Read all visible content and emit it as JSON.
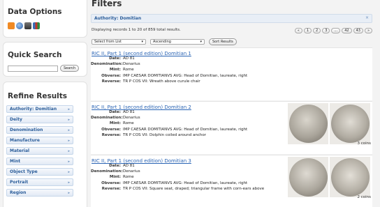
{
  "sidebar": {
    "data_options": "Data Options",
    "icons": [
      {
        "name": "rss-icon",
        "color": "#f08a24"
      },
      {
        "name": "globe-icon",
        "color": "#3a6db5"
      },
      {
        "name": "kml-icon",
        "color": "#666666"
      },
      {
        "name": "chart-icon",
        "color": "#c0392b"
      }
    ],
    "quick_search": "Quick Search",
    "search_button": "Search",
    "search_value": "",
    "refine_results": "Refine Results",
    "facets": [
      "Authority: Domitian",
      "Deity",
      "Denomination",
      "Manufacture",
      "Material",
      "Mint",
      "Object Type",
      "Portrait",
      "Region"
    ]
  },
  "main": {
    "title": "Filters",
    "filter_label": "Authority: Domitian",
    "filter_close": "×",
    "info": "Displaying records 1 to 20 of 859 total results.",
    "pager": [
      "«",
      "1",
      "2",
      "3",
      "...",
      "42",
      "43",
      "»"
    ],
    "sort_select": "Select from List",
    "sort_order": "Ascending",
    "sort_button": "Sort Results"
  },
  "records": [
    {
      "title": "RIC II, Part 1 (second edition) Domitian 1",
      "fields": [
        {
          "label": "Date:",
          "value": "AD 81"
        },
        {
          "label": "Denomination:",
          "value": "Denarius"
        },
        {
          "label": "Mint:",
          "value": "Rome"
        },
        {
          "label": "Obverse:",
          "value": "IMP CAESAR DOMITIANVS AVG: Head of Domitian, laureate, right"
        },
        {
          "label": "Reverse:",
          "value": "TR P COS VII: Wreath above curule chair"
        }
      ],
      "count": ""
    },
    {
      "title": "RIC II, Part 1 (second edition) Domitian 2",
      "fields": [
        {
          "label": "Date:",
          "value": "AD 81"
        },
        {
          "label": "Denomination:",
          "value": "Denarius"
        },
        {
          "label": "Mint:",
          "value": "Rome"
        },
        {
          "label": "Obverse:",
          "value": "IMP CAESAR DOMITIANVS AVG: Head of Domitian, laureate, right"
        },
        {
          "label": "Reverse:",
          "value": "TR P COS VII: Dolphin coiled around anchor"
        }
      ],
      "count": "3 coins"
    },
    {
      "title": "RIC II, Part 1 (second edition) Domitian 3",
      "fields": [
        {
          "label": "Date:",
          "value": "AD 81"
        },
        {
          "label": "Denomination:",
          "value": "Denarius"
        },
        {
          "label": "Mint:",
          "value": "Rome"
        },
        {
          "label": "Obverse:",
          "value": "IMP CAESAR DOMITIANVS AVG: Head of Domitian, laureate, right"
        },
        {
          "label": "Reverse:",
          "value": "TR P COS VII: Square seat, draped; triangular frame with corn-ears above"
        }
      ],
      "count": "2 coins"
    }
  ],
  "colors": {
    "link": "#2a64b4",
    "facet_text": "#2b5d9a",
    "filter_bg": "#e8eef6",
    "coin_silver": "#b8b4ac"
  }
}
